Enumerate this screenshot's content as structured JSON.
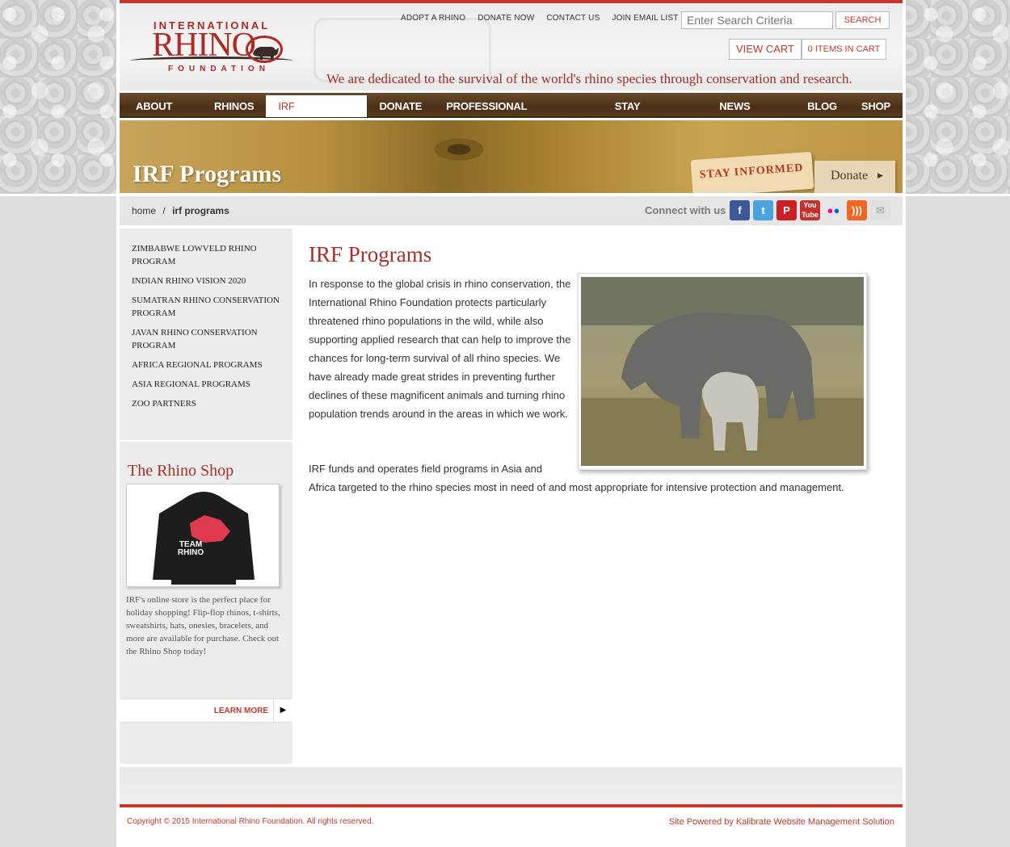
{
  "logo": {
    "line1": "INTERNATIONAL",
    "line2": "RHINO",
    "line3": "FOUNDATION"
  },
  "toplinks": [
    "ADOPT A RHINO",
    "DONATE NOW",
    "CONTACT US",
    "JOIN EMAIL LIST"
  ],
  "search": {
    "placeholder": "Enter Search Criteria",
    "button": "SEARCH"
  },
  "cart": {
    "view_label": "VIEW CART",
    "items_label": "0 ITEMS IN CART"
  },
  "tagline": "We are dedicated to the survival of the world's rhino species through conservation and research.",
  "nav": {
    "items": [
      "ABOUT IRF",
      "RHINOS",
      "IRF PROGRAMS",
      "DONATE",
      "PROFESSIONAL RESOURCES",
      "STAY INFORMED",
      "NEWS ROOM",
      "BLOG",
      "SHOP"
    ],
    "active": "IRF PROGRAMS"
  },
  "banner": {
    "title": "IRF Programs",
    "stay_informed": "STAY INFORMED",
    "donate": "Donate"
  },
  "breadcrumb": {
    "home": "home",
    "separator": "/",
    "current": "irf programs"
  },
  "social": {
    "label": "Connect with us",
    "icons": [
      "facebook-icon",
      "twitter-icon",
      "pinterest-icon",
      "youtube-icon",
      "flickr-icon",
      "rss-icon",
      "email-icon"
    ]
  },
  "sidebar": {
    "menu": [
      "ZIMBABWE LOWVELD RHINO PROGRAM",
      "INDIAN RHINO VISION 2020",
      "SUMATRAN RHINO CONSERVATION PROGRAM",
      "JAVAN RHINO CONSERVATION PROGRAM",
      "AFRICA REGIONAL PROGRAMS",
      "ASIA REGIONAL PROGRAMS",
      "ZOO PARTNERS"
    ],
    "shop_title": "The Rhino Shop",
    "shop_text": "IRF's online store is the perfect place for holiday shopping!  Flip-flop rhinos, t-shirts, sweatshirts, hats, onesies, bracelets, and more are available for purchase. Check out the Rhino Shop today!",
    "learn_more": "LEARN MORE",
    "shirt_text": "TEAM RHINO"
  },
  "main": {
    "title": "IRF Programs",
    "para1": "In response to the global crisis in rhino conservation, the International Rhino Foundation protects particularly threatened rhino populations in the wild, while also supporting applied research that can help to improve the chances for long-term survival of all rhino species. We have already made great strides in preventing further declines of these magnificent animals and turning rhino population trends around in the areas in which we work.",
    "para2_line1": "IRF funds and operates field programs in Asia and",
    "para2_line2": "Africa targeted to the rhino species most in need of and most appropriate for intensive protection and management."
  },
  "footer": {
    "copyright": "Copyright © 2015 International Rhino Foundation. All rights reserved.",
    "powered": "Site Powered by Kalibrate Website Management Solution"
  },
  "colors": {
    "brand_red": "#b02a23",
    "nav_brown": "#4a3018",
    "banner_gold": "#b8903f"
  }
}
